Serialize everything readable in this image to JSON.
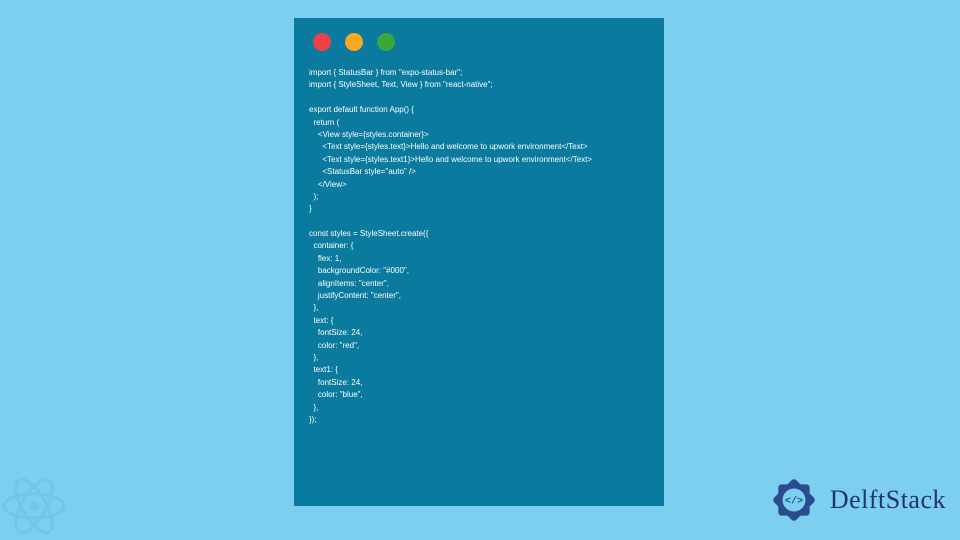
{
  "colors": {
    "page_bg": "#7dcff0",
    "window_bg": "#0a7a9e",
    "code_fg": "#ffffff",
    "light_red": "#ed4245",
    "light_yellow": "#f9a824",
    "light_green": "#3aa73a",
    "brand_fg": "#22356b"
  },
  "traffic_lights": [
    "red",
    "yellow",
    "green"
  ],
  "code_lines": [
    "import { StatusBar } from \"expo-status-bar\";",
    "import { StyleSheet, Text, View } from \"react-native\";",
    "",
    "export default function App() {",
    "  return (",
    "    <View style={styles.container}>",
    "      <Text style={styles.text}>Hello and welcome to upwork environment</Text>",
    "      <Text style={styles.text1}>Hello and welcome to upwork environment</Text>",
    "      <StatusBar style=\"auto\" />",
    "    </View>",
    "  );",
    "}",
    "",
    "const styles = StyleSheet.create({",
    "  container: {",
    "    flex: 1,",
    "    backgroundColor: \"#000\",",
    "    alignItems: \"center\",",
    "    justifyContent: \"center\",",
    "  },",
    "  text: {",
    "    fontSize: 24,",
    "    color: \"red\",",
    "  },",
    "  text1: {",
    "    fontSize: 24,",
    "    color: \"blue\",",
    "  },",
    "});"
  ],
  "brand": {
    "name": "DelftStack"
  }
}
